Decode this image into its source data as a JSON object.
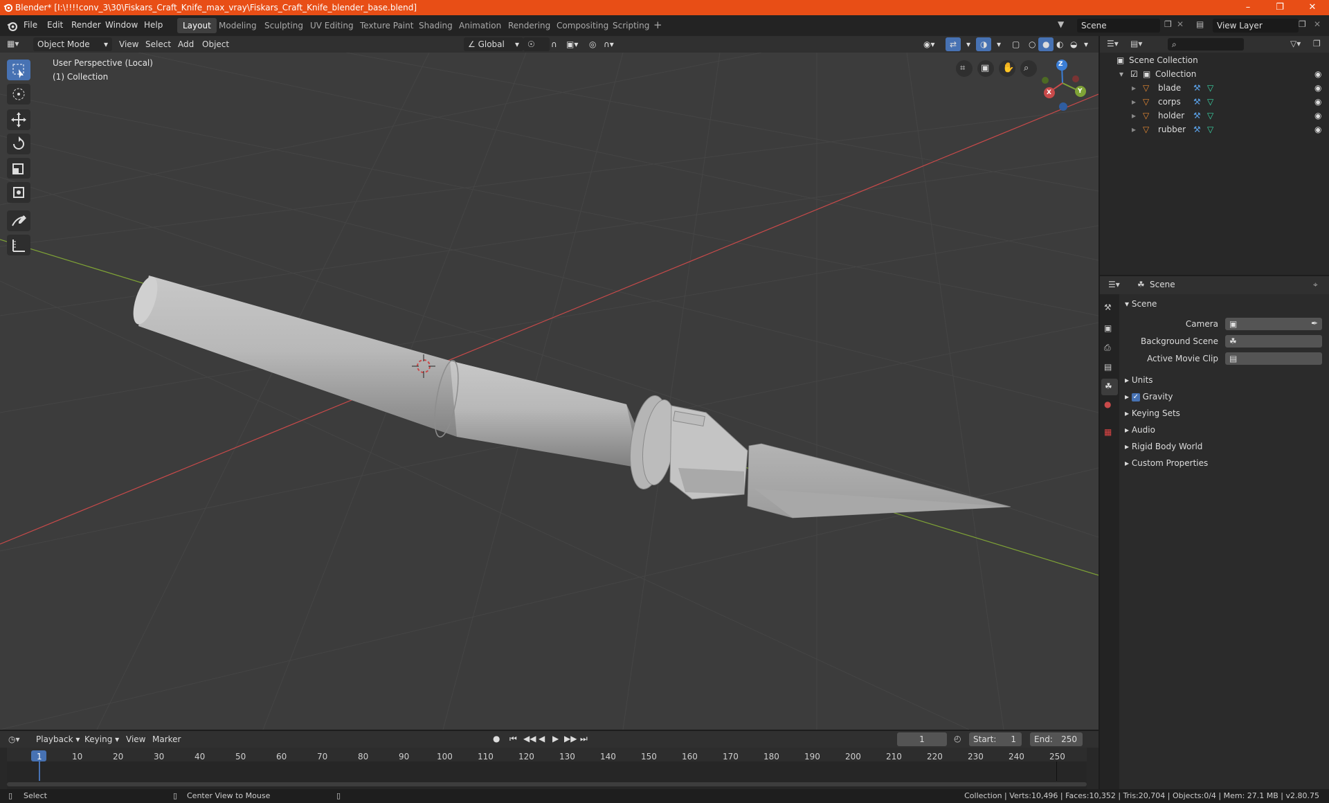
{
  "window": {
    "title": "Blender* [I:\\!!!!conv_3\\30\\Fiskars_Craft_Knife_max_vray\\Fiskars_Craft_Knife_blender_base.blend]",
    "minimize": "–",
    "maximize": "❐",
    "close": "✕"
  },
  "menubar": {
    "items": [
      "File",
      "Edit",
      "Render",
      "Window",
      "Help"
    ]
  },
  "workspaces": [
    "Layout",
    "Modeling",
    "Sculpting",
    "UV Editing",
    "Texture Paint",
    "Shading",
    "Animation",
    "Rendering",
    "Compositing",
    "Scripting"
  ],
  "active_workspace": "Layout",
  "scene_field": "Scene",
  "viewlayer_field": "View Layer",
  "viewport_header": {
    "mode": "Object Mode",
    "menus": [
      "View",
      "Select",
      "Add",
      "Object"
    ],
    "orientation": "Global"
  },
  "viewport": {
    "perspective": "User Perspective (Local)",
    "collection": "(1) Collection",
    "gizmo": {
      "z": "Z",
      "y": "Y",
      "x": "X"
    }
  },
  "outliner": {
    "root": "Scene Collection",
    "collection": "Collection",
    "objects": [
      "blade",
      "corps",
      "holder",
      "rubber"
    ]
  },
  "properties": {
    "header": "Scene",
    "panel_title": "Scene",
    "camera_label": "Camera",
    "background_scene_label": "Background Scene",
    "active_movie_clip_label": "Active Movie Clip",
    "sections": [
      "Units",
      "Gravity",
      "Keying Sets",
      "Audio",
      "Rigid Body World",
      "Custom Properties"
    ],
    "gravity_checked": true
  },
  "timeline": {
    "menus": [
      "Playback",
      "Keying",
      "View",
      "Marker"
    ],
    "current_frame": "1",
    "start_label": "Start:",
    "start": "1",
    "end_label": "End:",
    "end": "250",
    "ruler": [
      "1",
      "10",
      "20",
      "30",
      "40",
      "50",
      "60",
      "70",
      "80",
      "90",
      "100",
      "110",
      "120",
      "130",
      "140",
      "150",
      "160",
      "170",
      "180",
      "190",
      "200",
      "210",
      "220",
      "230",
      "240",
      "250"
    ]
  },
  "statusbar": {
    "left": "Select",
    "middle": "Center View to Mouse",
    "right": "Collection | Verts:10,496 | Faces:10,352 | Tris:20,704 | Objects:0/4 | Mem: 27.1 MB | v2.80.75"
  },
  "colors": {
    "titlebar": "#e84e16",
    "accent": "#4772b3",
    "viewport_bg": "#3c3c3c",
    "x_axis": "#c94a4a",
    "y_axis": "#7fa336",
    "z_axis": "#3b7ed6",
    "object_icon": "#e88a33",
    "modifier_icon": "#5aa0e6",
    "mesh_icon": "#3ad6a7"
  }
}
